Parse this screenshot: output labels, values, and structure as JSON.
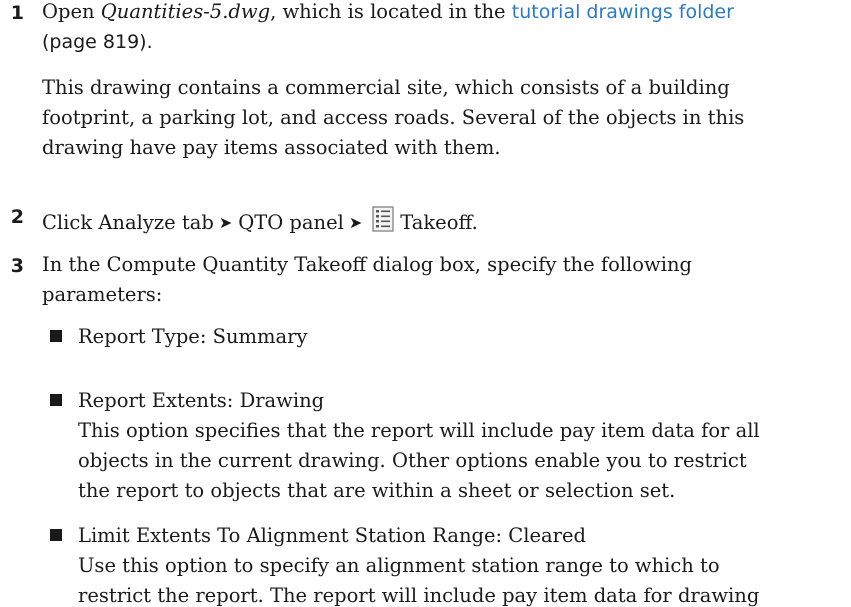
{
  "steps": [
    {
      "number": "1",
      "line1_pre": "Open ",
      "filename": "Quantities-5.dwg",
      "line1_mid": ", which is located in the ",
      "link_text": "tutorial drawings folder",
      "page_ref": "(page 819).",
      "paragraph": [
        "This drawing contains a commercial site, which consists of a building",
        "footprint, a parking lot, and access roads. Several of the objects in this",
        "drawing have pay items associated with them."
      ]
    },
    {
      "number": "2",
      "part1": "Click Analyze tab",
      "part2": "QTO panel",
      "part3": "Takeoff.",
      "arrow": "➤",
      "icon": "takeoff-icon"
    },
    {
      "number": "3",
      "line1": "In the Compute Quantity Takeoff dialog box, specify the following",
      "line2": "parameters:",
      "bullets": [
        {
          "title": "Report Type: Summary",
          "desc": []
        },
        {
          "title": "Report Extents: Drawing",
          "desc": [
            "This option specifies that the report will include pay item data for all",
            "objects in the current drawing. Other options enable you to restrict",
            "the report to objects that are within a sheet or selection set."
          ]
        },
        {
          "title": "Limit Extents To Alignment Station Range: Cleared",
          "desc": [
            "Use this option to specify an alignment station range to which to",
            "restrict the report. The report will include pay item data for drawing"
          ]
        }
      ]
    }
  ],
  "colors": {
    "link": "#2b7ac6",
    "text": "#1a1a1a"
  }
}
